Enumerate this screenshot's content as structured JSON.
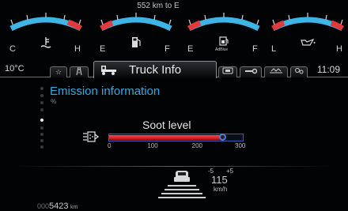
{
  "gauges": {
    "range_text": "552 km to E",
    "coolant": {
      "left_label": "C",
      "right_label": "H",
      "icon": "coolant-temperature-icon"
    },
    "fuel": {
      "left_label": "E",
      "right_label": "F",
      "icon": "fuel-pump-icon"
    },
    "adblue": {
      "left_label": "E",
      "right_label": "F",
      "icon": "adblue-tank-icon",
      "icon_text": "AdBlue"
    },
    "oil": {
      "left_label": "L",
      "right_label": "H",
      "icon": "oil-can-icon"
    },
    "colors": {
      "arc": "#3fb4e6",
      "redzone": "#e23a3a",
      "ticks": "#d0d0d0"
    }
  },
  "tabbar": {
    "temperature": "10°C",
    "time": "11:09",
    "active_tab_label": "Truck Info",
    "tabs": [
      {
        "icon": "star-icon"
      },
      {
        "icon": "road-icon"
      },
      {
        "icon": "truck-info-icon"
      },
      {
        "icon": "telephone-icon"
      },
      {
        "icon": "wrench-icon"
      },
      {
        "icon": "suspension-icon"
      },
      {
        "icon": "settings-icon"
      }
    ]
  },
  "content": {
    "section_title": "Emission information",
    "scroll_unit": "%",
    "scroll_dots": 9,
    "scroll_active_index": 4,
    "soot": {
      "label": "Soot level",
      "value": 255,
      "max": 300,
      "ticks": [
        "0",
        "100",
        "200",
        "300"
      ],
      "icon": "particulate-filter-icon",
      "colors": {
        "fill": "#d41b1b",
        "frame": "#3d58b8"
      }
    },
    "speed": {
      "minus": "-5",
      "plus": "+5",
      "value": "115",
      "unit": "km/h",
      "icon": "vehicle-distance-icon"
    },
    "odometer": {
      "leading_zeros": "000",
      "value": "5423",
      "unit": "km"
    }
  }
}
